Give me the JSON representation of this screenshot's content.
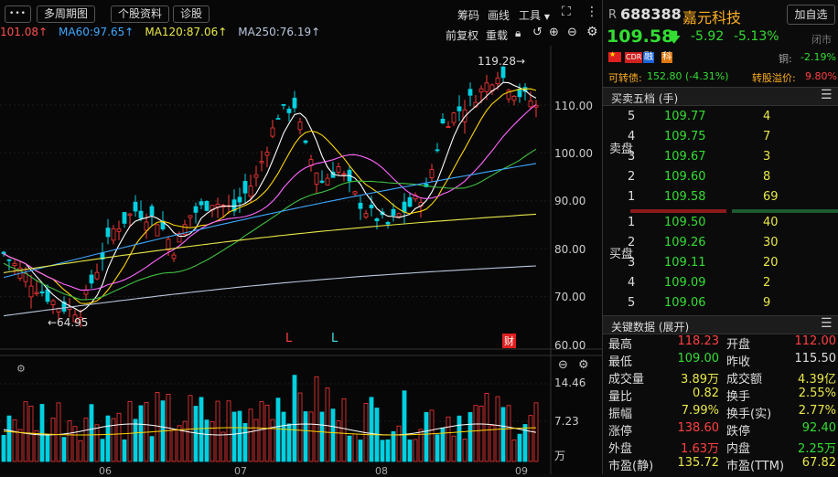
{
  "toolbar": {
    "menu_btn": "•••",
    "period_btn": "多周期图",
    "info_btn": "个股资料",
    "diag_btn": "诊股",
    "chips": "筹码",
    "draw": "画线",
    "tools": "工具",
    "fq": "前复权",
    "reload": "重载"
  },
  "ma_legend": [
    {
      "text": "101.08↑",
      "color": "#ff5050"
    },
    {
      "text": "MA60:97.65↑",
      "color": "#3ea8ff"
    },
    {
      "text": "MA120:87.06↑",
      "color": "#e8e84a"
    },
    {
      "text": "MA250:76.19↑",
      "color": "#b9c7dd"
    }
  ],
  "price_axis": {
    "ticks": [
      "110.00",
      "100.00",
      "90.00",
      "80.00",
      "70.00",
      "60.00"
    ]
  },
  "volume_axis": {
    "ticks": [
      "14.46",
      "7.23"
    ],
    "unit": "万"
  },
  "month_labels": [
    "06",
    "07",
    "08",
    "09"
  ],
  "chart_annotations": {
    "high": "119.28→",
    "low": "←64.95",
    "marks": [
      "L",
      "L",
      "财"
    ]
  },
  "stock": {
    "prefix": "R",
    "code": "688388",
    "name": "嘉元科技",
    "add_btn": "加自选",
    "price": "109.58",
    "change": "-5.92",
    "pct": "-5.13%",
    "status": "闭市",
    "badges": [
      "CDR",
      "融",
      "科"
    ],
    "copper_label": "铜:",
    "copper_val": "-2.19%",
    "convert_label": "可转债:",
    "convert_val": "152.80 (-4.31%)",
    "premium_label": "转股溢价:",
    "premium_val": "9.80%"
  },
  "orderbook": {
    "title": "买卖五档 (手)",
    "sell_label": "卖盘",
    "buy_label": "买盘",
    "sell": [
      {
        "lvl": "5",
        "price": "109.77",
        "vol": "4"
      },
      {
        "lvl": "4",
        "price": "109.75",
        "vol": "7"
      },
      {
        "lvl": "3",
        "price": "109.67",
        "vol": "3"
      },
      {
        "lvl": "2",
        "price": "109.60",
        "vol": "8"
      },
      {
        "lvl": "1",
        "price": "109.58",
        "vol": "69"
      }
    ],
    "buy": [
      {
        "lvl": "1",
        "price": "109.50",
        "vol": "40"
      },
      {
        "lvl": "2",
        "price": "109.26",
        "vol": "30"
      },
      {
        "lvl": "3",
        "price": "109.11",
        "vol": "20"
      },
      {
        "lvl": "4",
        "price": "109.09",
        "vol": "2"
      },
      {
        "lvl": "5",
        "price": "109.06",
        "vol": "9"
      }
    ]
  },
  "keydata": {
    "title": "关键数据 (展开)",
    "rows": [
      {
        "l1": "最高",
        "v1": "118.23",
        "c1": "#ff4040",
        "l2": "开盘",
        "v2": "112.00",
        "c2": "#ff4040"
      },
      {
        "l1": "最低",
        "v1": "109.00",
        "c1": "#33dd33",
        "l2": "昨收",
        "v2": "115.50",
        "c2": "#dddddd"
      },
      {
        "l1": "成交量",
        "v1": "3.89万",
        "c1": "#e8e84a",
        "l2": "成交额",
        "v2": "4.39亿",
        "c2": "#e8e84a"
      },
      {
        "l1": "量比",
        "v1": "0.82",
        "c1": "#e8e84a",
        "l2": "换手",
        "v2": "2.55%",
        "c2": "#e8e84a"
      },
      {
        "l1": "振幅",
        "v1": "7.99%",
        "c1": "#e8e84a",
        "l2": "换手(实)",
        "v2": "2.77%",
        "c2": "#e8e84a"
      },
      {
        "l1": "涨停",
        "v1": "138.60",
        "c1": "#ff4040",
        "l2": "跌停",
        "v2": "92.40",
        "c2": "#33dd33"
      },
      {
        "l1": "外盘",
        "v1": "1.63万",
        "c1": "#ff4040",
        "l2": "内盘",
        "v2": "2.25万",
        "c2": "#33dd33"
      },
      {
        "l1": "市盈(静)",
        "v1": "135.72",
        "c1": "#e8e84a",
        "l2": "市盈(TTM)",
        "v2": "67.82",
        "c2": "#e8e84a"
      }
    ]
  }
}
